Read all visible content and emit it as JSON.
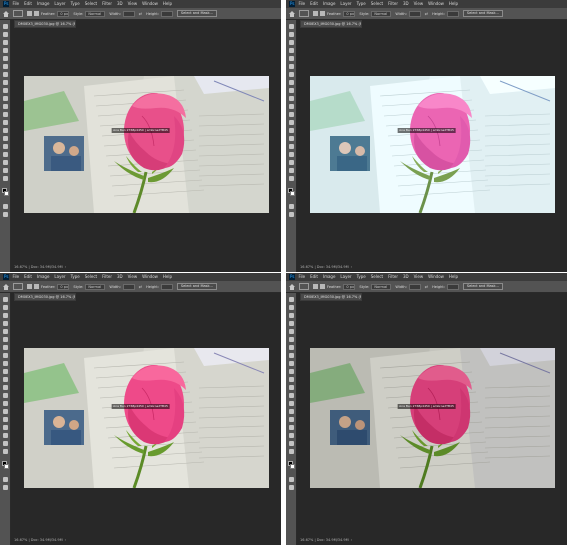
{
  "panels": [
    {
      "menu": [
        "File",
        "Edit",
        "Image",
        "Layer",
        "Type",
        "Select",
        "Filter",
        "3D",
        "View",
        "Window",
        "Help"
      ],
      "doc_tab": "DM0EX3_IMG030.jpg @ 16.7% (RGB/8) *",
      "feather_label": "Feather:",
      "feather_value": "0 px",
      "style_label": "Style:",
      "style_value": "Normal",
      "width_label": "Width:",
      "height_label": "Height:",
      "select_mask": "Select and Mask...",
      "watermark": "Ana Ben 2768p4450 | ambroadTB45",
      "status": "16.67% | Doc: 34.9M/34.9M"
    },
    {
      "menu": [
        "File",
        "Edit",
        "Image",
        "Layer",
        "Type",
        "Select",
        "Filter",
        "3D",
        "View",
        "Window",
        "Help"
      ],
      "doc_tab": "DM0EX3_IMG030.jpg @ 16.7% (RGB/8) *",
      "feather_label": "Feather:",
      "feather_value": "0 px",
      "style_label": "Style:",
      "style_value": "Normal",
      "width_label": "Width:",
      "height_label": "Height:",
      "select_mask": "Select and Mask...",
      "watermark": "Ana Ben 2768p4450 | ambroadTB45",
      "status": "16.67% | Doc: 34.9M/34.9M"
    },
    {
      "menu": [
        "File",
        "Edit",
        "Image",
        "Layer",
        "Type",
        "Select",
        "Filter",
        "3D",
        "View",
        "Window",
        "Help"
      ],
      "doc_tab": "DM0EX3_IMG030.jpg @ 16.7% (RGB/8) *",
      "feather_label": "Feather:",
      "feather_value": "0 px",
      "style_label": "Style:",
      "style_value": "Normal",
      "width_label": "Width:",
      "height_label": "Height:",
      "select_mask": "Select and Mask...",
      "watermark": "Ana Ben 2768p4450 | ambroadTB45",
      "status": "16.67% | Doc: 34.9M/34.9M"
    },
    {
      "menu": [
        "File",
        "Edit",
        "Image",
        "Layer",
        "Type",
        "Select",
        "Filter",
        "3D",
        "View",
        "Window",
        "Help"
      ],
      "doc_tab": "DM0EX3_IMG030.jpg @ 16.7% (RGB/8) *",
      "feather_label": "Feather:",
      "feather_value": "0 px",
      "style_label": "Style:",
      "style_value": "Normal",
      "width_label": "Width:",
      "height_label": "Height:",
      "select_mask": "Select and Mask...",
      "watermark": "Ana Ben 2768p4450 | ambroadTB45",
      "status": "16.67% | Doc: 34.9M/34.9M"
    }
  ],
  "colors": {
    "workspace": "#282828",
    "menubar": "#3b3b3b",
    "options_bar": "#535353",
    "rose": "#e8508a",
    "stem": "#5e8a2a",
    "newspaper": "#dcdcd4"
  },
  "icons": [
    "photoshop-logo",
    "home-icon",
    "marquee-tool-icon",
    "swap-icon"
  ]
}
